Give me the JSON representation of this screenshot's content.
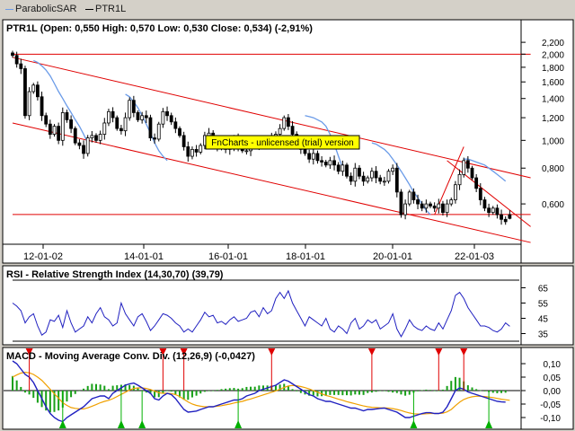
{
  "legend": [
    {
      "label": "ParabolicSAR",
      "color": "#6a9be8"
    },
    {
      "label": "PTR1L",
      "color": "#000000"
    }
  ],
  "watermark": "FnCharts - unlicensed (trial) version",
  "chart_data": [
    {
      "type": "candlestick",
      "title": "PTR1L (Open: 0,550  High: 0,570  Low: 0,530  Close: 0,534) (-2,91%)",
      "x_tick_labels": [
        "12-01-02",
        "14-01-01",
        "16-01-01",
        "18-01-01",
        "20-01-01",
        "22-01-03"
      ],
      "y_tick_labels": [
        "2,200",
        "2,000",
        "1,800",
        "1,600",
        "1,400",
        "1,200",
        "1,000",
        "0,800",
        "0,600"
      ],
      "y_scale": "log",
      "ylim": [
        0.48,
        2.25
      ],
      "grid": false,
      "last_bar": {
        "open": 0.55,
        "high": 0.57,
        "low": 0.53,
        "close": 0.534,
        "change_pct": -2.91
      },
      "n_bars": 120,
      "close_series": [
        1.98,
        1.85,
        1.78,
        1.22,
        1.48,
        1.56,
        1.42,
        1.22,
        1.14,
        1.05,
        1.12,
        1.0,
        1.25,
        1.18,
        1.1,
        0.98,
        0.96,
        0.9,
        1.02,
        1.04,
        1.0,
        1.05,
        1.15,
        1.26,
        1.2,
        1.1,
        1.08,
        1.2,
        1.38,
        1.25,
        1.18,
        1.22,
        1.2,
        1.02,
        1.01,
        1.14,
        1.26,
        1.22,
        1.16,
        1.1,
        1.04,
        0.95,
        0.88,
        0.93,
        0.91,
        0.96,
        1.04,
        1.06,
        1.0,
        0.95,
        0.94,
        0.93,
        0.94,
        1.02,
        0.95,
        0.92,
        0.92,
        0.99,
        0.96,
        0.97,
        0.98,
        1.0,
        1.02,
        1.05,
        1.1,
        1.2,
        1.12,
        1.05,
        1.0,
        0.93,
        0.9,
        0.86,
        0.9,
        0.85,
        0.84,
        0.82,
        0.85,
        0.82,
        0.78,
        0.82,
        0.75,
        0.72,
        0.8,
        0.75,
        0.72,
        0.74,
        0.78,
        0.74,
        0.72,
        0.72,
        0.78,
        0.8,
        0.66,
        0.55,
        0.6,
        0.66,
        0.62,
        0.6,
        0.58,
        0.6,
        0.59,
        0.58,
        0.6,
        0.56,
        0.6,
        0.62,
        0.7,
        0.76,
        0.85,
        0.8,
        0.74,
        0.68,
        0.62,
        0.58,
        0.56,
        0.58,
        0.55,
        0.53,
        0.52,
        0.534
      ],
      "parabolic_sar_series": [
        {
          "from_bar": 5,
          "values": [
            1.9,
            1.87,
            1.82,
            1.76,
            1.68,
            1.58,
            1.48,
            1.4,
            1.32,
            1.25,
            1.18,
            1.12,
            1.05,
            0.98
          ]
        },
        {
          "from_bar": 27,
          "values": [
            1.45,
            1.42,
            1.36,
            1.3,
            1.22,
            1.14,
            1.06,
            0.98,
            0.92,
            0.88,
            0.85
          ]
        },
        {
          "from_bar": 70,
          "values": [
            1.22,
            1.21,
            1.2,
            1.18,
            1.16,
            1.12,
            1.05,
            0.97,
            0.88,
            0.8
          ]
        },
        {
          "from_bar": 86,
          "values": [
            0.98,
            0.97,
            0.95,
            0.93,
            0.9,
            0.86,
            0.82,
            0.78,
            0.74,
            0.7,
            0.66,
            0.63,
            0.6,
            0.57,
            0.55
          ]
        },
        {
          "from_bar": 108,
          "values": [
            0.86,
            0.86,
            0.85,
            0.84,
            0.83,
            0.82,
            0.8,
            0.78,
            0.76,
            0.74,
            0.72
          ]
        }
      ],
      "trend_lines": [
        {
          "color": "#e00000",
          "from": {
            "bar": 0,
            "price": 2.0
          },
          "to": {
            "bar": 124,
            "price": 2.0
          }
        },
        {
          "color": "#e00000",
          "from": {
            "bar": 0,
            "price": 0.551
          },
          "to": {
            "bar": 124,
            "price": 0.551
          }
        },
        {
          "color": "#e00000",
          "from": {
            "bar": 0,
            "price": 1.95
          },
          "to": {
            "bar": 124,
            "price": 0.74
          }
        },
        {
          "color": "#e00000",
          "from": {
            "bar": 0,
            "price": 1.15
          },
          "to": {
            "bar": 124,
            "price": 0.44
          }
        },
        {
          "color": "#e00000",
          "from": {
            "bar": 104,
            "price": 0.85
          },
          "to": {
            "bar": 124,
            "price": 0.5
          }
        },
        {
          "color": "#e00000",
          "from": {
            "bar": 101,
            "price": 0.55
          },
          "to": {
            "bar": 108,
            "price": 0.95
          }
        }
      ]
    },
    {
      "type": "line",
      "title": "RSI - Relative Strength Index (14,30,70) (39,79)",
      "y_tick_labels": [
        "65",
        "55",
        "45",
        "35"
      ],
      "ylim": [
        30,
        70
      ],
      "reference_lines": [
        30,
        70
      ],
      "color": "#2020c0",
      "value": 39.79,
      "values": [
        55,
        53,
        50,
        42,
        46,
        48,
        40,
        34,
        36,
        44,
        43,
        47,
        39,
        50,
        42,
        36,
        38,
        40,
        46,
        42,
        48,
        52,
        46,
        44,
        40,
        42,
        55,
        48,
        44,
        40,
        46,
        48,
        43,
        37,
        40,
        44,
        48,
        47,
        45,
        42,
        40,
        36,
        38,
        36,
        40,
        44,
        49,
        46,
        47,
        42,
        43,
        41,
        44,
        46,
        43,
        44,
        45,
        49,
        50,
        46,
        52,
        48,
        50,
        58,
        62,
        58,
        63,
        55,
        50,
        45,
        40,
        46,
        44,
        42,
        40,
        45,
        38,
        36,
        40,
        38,
        35,
        42,
        45,
        38,
        40,
        44,
        42,
        44,
        38,
        40,
        42,
        48,
        38,
        33,
        38,
        44,
        40,
        38,
        37,
        40,
        38,
        37,
        42,
        38,
        44,
        50,
        60,
        62,
        58,
        52,
        48,
        44,
        40,
        40,
        39,
        37,
        36,
        38,
        42,
        39.79
      ]
    },
    {
      "type": "macd",
      "title": "MACD - Moving Average Conv. Div. (12,26,9) (-0,0427)",
      "y_tick_labels": [
        "0,10",
        "0,05",
        "0,00",
        "-0,05",
        "-0,10"
      ],
      "ylim": [
        -0.13,
        0.13
      ],
      "value": -0.0427,
      "macd_color": "#2020c0",
      "signal_color": "#f0a000",
      "histogram_color": "#18a018",
      "macd_values": [
        0.11,
        0.1,
        0.08,
        0.06,
        0.05,
        0.03,
        0.0,
        -0.03,
        -0.06,
        -0.085,
        -0.1,
        -0.11,
        -0.115,
        -0.1,
        -0.09,
        -0.08,
        -0.07,
        -0.06,
        -0.045,
        -0.03,
        -0.025,
        -0.02,
        -0.02,
        -0.03,
        -0.01,
        0.0,
        0.01,
        0.02,
        0.025,
        0.028,
        0.02,
        0.01,
        0.0,
        -0.01,
        -0.03,
        -0.035,
        -0.02,
        -0.01,
        -0.015,
        -0.03,
        -0.05,
        -0.07,
        -0.08,
        -0.078,
        -0.076,
        -0.07,
        -0.065,
        -0.06,
        -0.06,
        -0.055,
        -0.05,
        -0.045,
        -0.04,
        -0.035,
        -0.035,
        -0.03,
        -0.02,
        -0.015,
        -0.01,
        0.0,
        0.005,
        0.01,
        0.015,
        0.02,
        0.03,
        0.04,
        0.035,
        0.025,
        0.015,
        0.005,
        -0.005,
        -0.015,
        -0.02,
        -0.03,
        -0.035,
        -0.04,
        -0.04,
        -0.045,
        -0.05,
        -0.055,
        -0.06,
        -0.065,
        -0.065,
        -0.07,
        -0.075,
        -0.07,
        -0.07,
        -0.068,
        -0.066,
        -0.065,
        -0.07,
        -0.075,
        -0.08,
        -0.09,
        -0.1,
        -0.1,
        -0.095,
        -0.09,
        -0.085,
        -0.082,
        -0.082,
        -0.085,
        -0.085,
        -0.08,
        -0.06,
        -0.03,
        0.0,
        0.01,
        0.005,
        -0.005,
        -0.01,
        -0.015,
        -0.02,
        -0.025,
        -0.03,
        -0.035,
        -0.04,
        -0.042,
        -0.0427
      ],
      "signal_values": [
        0.05,
        0.058,
        0.065,
        0.068,
        0.066,
        0.06,
        0.05,
        0.038,
        0.022,
        0.005,
        -0.012,
        -0.028,
        -0.045,
        -0.055,
        -0.063,
        -0.066,
        -0.068,
        -0.068,
        -0.064,
        -0.058,
        -0.052,
        -0.045,
        -0.04,
        -0.036,
        -0.03,
        -0.022,
        -0.014,
        -0.006,
        0.002,
        0.008,
        0.01,
        0.01,
        0.008,
        0.004,
        -0.002,
        -0.008,
        -0.01,
        -0.01,
        -0.011,
        -0.015,
        -0.022,
        -0.032,
        -0.042,
        -0.05,
        -0.055,
        -0.058,
        -0.06,
        -0.06,
        -0.06,
        -0.058,
        -0.056,
        -0.053,
        -0.05,
        -0.046,
        -0.043,
        -0.04,
        -0.035,
        -0.031,
        -0.026,
        -0.021,
        -0.016,
        -0.011,
        -0.006,
        -0.001,
        0.005,
        0.012,
        0.017,
        0.019,
        0.018,
        0.015,
        0.011,
        0.006,
        0.0,
        -0.006,
        -0.012,
        -0.018,
        -0.022,
        -0.027,
        -0.032,
        -0.036,
        -0.041,
        -0.045,
        -0.049,
        -0.053,
        -0.057,
        -0.06,
        -0.062,
        -0.063,
        -0.064,
        -0.064,
        -0.065,
        -0.067,
        -0.07,
        -0.074,
        -0.079,
        -0.083,
        -0.086,
        -0.087,
        -0.087,
        -0.086,
        -0.085,
        -0.085,
        -0.085,
        -0.084,
        -0.079,
        -0.07,
        -0.056,
        -0.043,
        -0.033,
        -0.027,
        -0.023,
        -0.021,
        -0.021,
        -0.022,
        -0.024,
        -0.026,
        -0.029,
        -0.032,
        -0.034,
        -0.036
      ],
      "sell_signal_bars": [
        4,
        36,
        41,
        62,
        86,
        102,
        108
      ],
      "buy_signal_bars": [
        12,
        26,
        31,
        54,
        96,
        114
      ]
    }
  ]
}
